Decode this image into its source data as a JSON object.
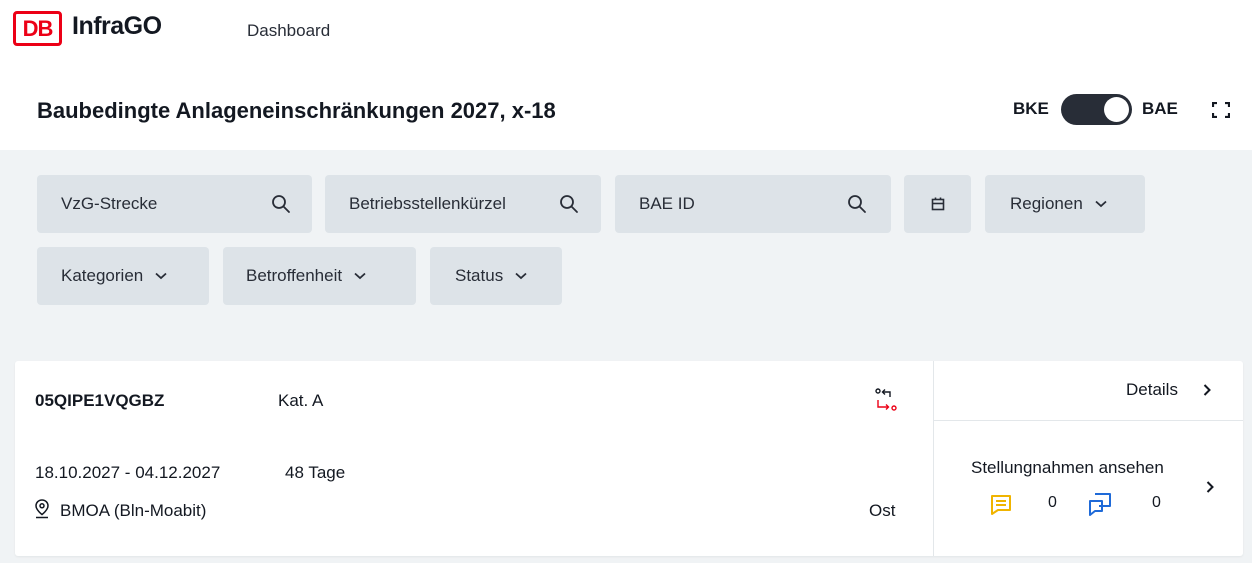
{
  "header": {
    "logo_text": "DB",
    "brand": "InfraGO",
    "nav": {
      "dashboard": "Dashboard"
    }
  },
  "title_bar": {
    "title": "Baubedingte Anlageneinschränkungen 2027, x-18",
    "toggle": {
      "left_label": "BKE",
      "right_label": "BAE",
      "selected": "BAE"
    }
  },
  "filters": {
    "vzg_strecke": {
      "placeholder": "VzG-Strecke"
    },
    "betriebsstellenkuerzel": {
      "placeholder": "Betriebsstellenkürzel"
    },
    "bae_id": {
      "placeholder": "BAE ID"
    },
    "regionen": "Regionen",
    "kategorien": "Kategorien",
    "betroffenheit": "Betroffenheit",
    "status": "Status"
  },
  "card": {
    "id": "05QIPE1VQGBZ",
    "category": "Kat. A",
    "date_range": "18.10.2027 - 04.12.2027",
    "duration": "48 Tage",
    "location": "BMOA (Bln-Moabit)",
    "region": "Ost",
    "details_label": "Details",
    "statements_label": "Stellungnahmen ansehen",
    "comment_count": "0",
    "reply_count": "0"
  },
  "colors": {
    "db_red": "#ec0016",
    "comment_icon": "#f0b400",
    "reply_icon": "#1f6ad8",
    "filter_bg": "#dde3e8",
    "toggle_bg": "#282d37"
  }
}
